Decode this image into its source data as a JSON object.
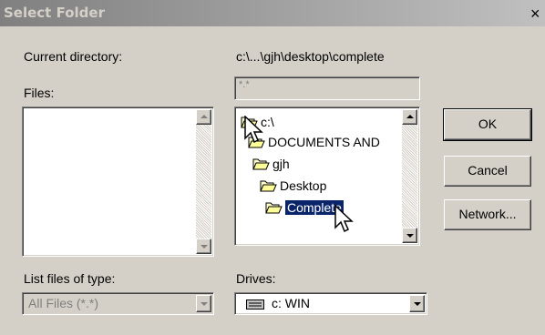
{
  "window": {
    "title": "Select Folder",
    "close_glyph": "×"
  },
  "labels": {
    "current_directory": "Current directory:",
    "current_directory_value": "c:\\...\\gjh\\desktop\\complete",
    "files": "Files:",
    "list_files_of_type": "List files of type:",
    "drives": "Drives:"
  },
  "filename_input": {
    "value": "*.*"
  },
  "folder_tree": {
    "items": [
      {
        "label": "c:\\",
        "icon": "open-folder-icon"
      },
      {
        "label": "DOCUMENTS AND",
        "icon": "open-folder-icon"
      },
      {
        "label": "gjh",
        "icon": "open-folder-icon"
      },
      {
        "label": "Desktop",
        "icon": "open-folder-icon"
      },
      {
        "label": "Complete",
        "icon": "open-folder-icon",
        "selected": true
      }
    ]
  },
  "file_type_select": {
    "value": "All Files (*.*)",
    "disabled": true
  },
  "drives_select": {
    "value": "c: WIN",
    "icon": "hard-drive-icon"
  },
  "buttons": {
    "ok": "OK",
    "cancel": "Cancel",
    "network": "Network..."
  },
  "colors": {
    "title_gradient_start": "#808080",
    "title_gradient_end": "#c0c0c0",
    "selection": "#0a246a",
    "dialog_face": "#d4d0c8"
  }
}
